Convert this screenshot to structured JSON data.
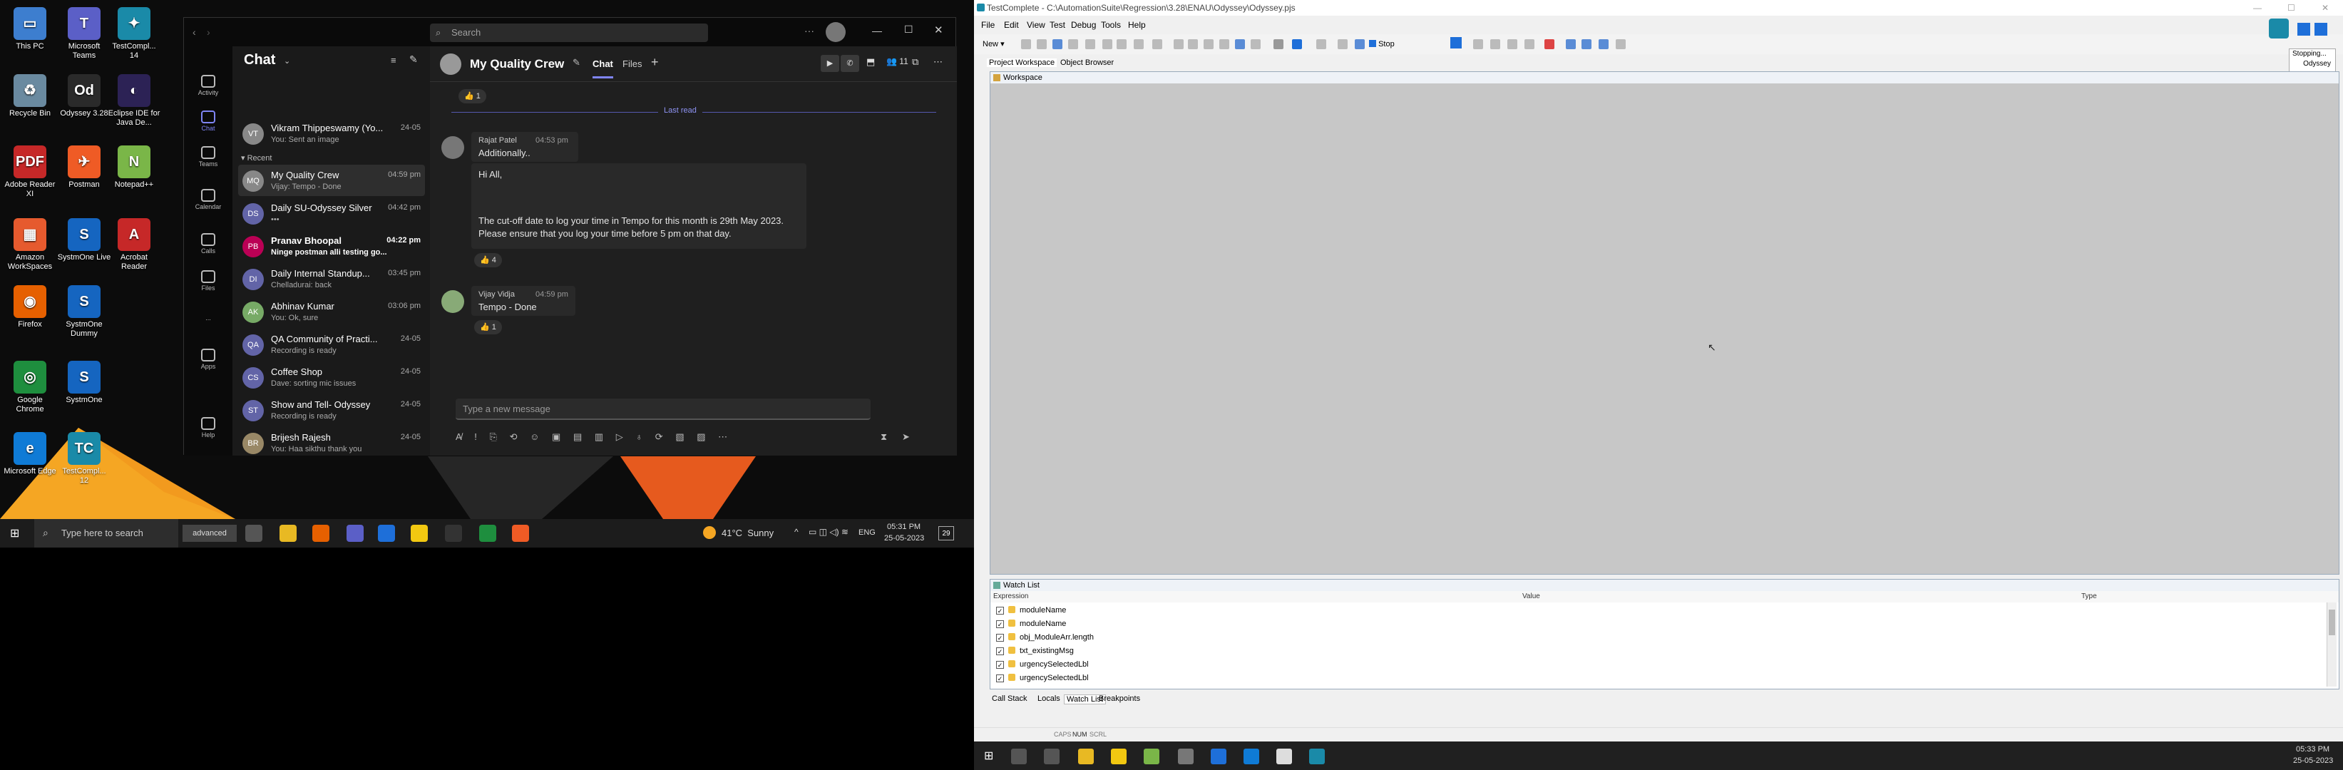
{
  "desktop": {
    "icons": [
      {
        "label": "This PC",
        "color": "#3d7ecf",
        "glyph": "▭"
      },
      {
        "label": "Microsoft Teams",
        "color": "#5b5fc7",
        "glyph": "T"
      },
      {
        "label": "TestCompl... 14",
        "color": "#1a8aa8",
        "glyph": "✦"
      },
      {
        "label": "Recycle Bin",
        "color": "#6a8aa0",
        "glyph": "♻"
      },
      {
        "label": "Odyssey 3.28",
        "color": "#2a2a2a",
        "glyph": "Od"
      },
      {
        "label": "Eclipse IDE for Java De...",
        "color": "#2c2255",
        "glyph": "◐"
      },
      {
        "label": "Adobe Reader XI",
        "color": "#c62828",
        "glyph": "PDF"
      },
      {
        "label": "Postman",
        "color": "#ef5b25",
        "glyph": "✈"
      },
      {
        "label": "Notepad++",
        "color": "#7ab648",
        "glyph": "N"
      },
      {
        "label": "Amazon WorkSpaces",
        "color": "#e65a2e",
        "glyph": "▦"
      },
      {
        "label": "SystmOne Live",
        "color": "#1565c0",
        "glyph": "S"
      },
      {
        "label": "Acrobat Reader",
        "color": "#c62828",
        "glyph": "A"
      },
      {
        "label": "Firefox",
        "color": "#e66000",
        "glyph": "◉"
      },
      {
        "label": "SystmOne Dummy",
        "color": "#1565c0",
        "glyph": "S"
      },
      {
        "label": "Google Chrome",
        "color": "#1e8e3e",
        "glyph": "◎"
      },
      {
        "label": "SystmOne",
        "color": "#1565c0",
        "glyph": "S"
      },
      {
        "label": "Microsoft Edge",
        "color": "#0f7bd6",
        "glyph": "e"
      },
      {
        "label": "TestCompl... 12",
        "color": "#1a8aa8",
        "glyph": "TC"
      }
    ]
  },
  "teams": {
    "search_placeholder": "Search",
    "rail": [
      "Activity",
      "Chat",
      "Teams",
      "Calendar",
      "Calls",
      "Files",
      "...",
      "Apps",
      "Help"
    ],
    "chat_header": "Chat",
    "recent_label": "Recent",
    "pinned_row": {
      "name": "Vikram Thippeswamy (Yo...",
      "preview": "You: Sent an image",
      "time": "24-05"
    },
    "chats": [
      {
        "name": "My Quality Crew",
        "preview": "Vijay: Tempo - Done",
        "time": "04:59 pm",
        "initials": "MQ",
        "bold": false
      },
      {
        "name": "Daily SU-Odyssey Silver",
        "preview": "•••",
        "time": "04:42 pm",
        "initials": "DS",
        "bold": false
      },
      {
        "name": "Pranav Bhoopal",
        "preview": "Ninge postman alli testing go...",
        "time": "04:22 pm",
        "initials": "PB",
        "bold": true
      },
      {
        "name": "Daily Internal Standup...",
        "preview": "Chelladurai: back",
        "time": "03:45 pm",
        "initials": "DI",
        "bold": false
      },
      {
        "name": "Abhinav Kumar",
        "preview": "You: Ok, sure",
        "time": "03:06 pm",
        "initials": "AK",
        "bold": false
      },
      {
        "name": "QA Community of Practi...",
        "preview": "Recording is ready",
        "time": "24-05",
        "initials": "QA",
        "bold": false
      },
      {
        "name": "Coffee Shop",
        "preview": "Dave: sorting mic issues",
        "time": "24-05",
        "initials": "CS",
        "bold": false
      },
      {
        "name": "Show and Tell- Odyssey",
        "preview": "Recording is ready",
        "time": "24-05",
        "initials": "ST",
        "bold": false
      },
      {
        "name": "Brijesh Rajesh",
        "preview": "You: Haa sikthu thank you",
        "time": "24-05",
        "initials": "BR",
        "bold": false
      }
    ],
    "conversation": {
      "title": "My Quality Crew",
      "tab_chat": "Chat",
      "tab_files": "Files",
      "participants": "11",
      "last_read": "Last read",
      "top_reaction": "👍 1",
      "messages": [
        {
          "author": "Rajat Patel",
          "time": "04:53 pm",
          "text": "Additionally.."
        },
        {
          "author": "",
          "time": "",
          "text": "Hi All,"
        },
        {
          "author": "",
          "time": "",
          "text": "The cut-off date to log your time in Tempo for this month is 29th May 2023. Please ensure that you log your time before 5 pm on that day."
        },
        {
          "author": "Vijay Vidja",
          "time": "04:59 pm",
          "text": "Tempo - Done"
        }
      ],
      "reaction_msg2": "👍 4",
      "reaction_msg3": "👍 1",
      "compose_placeholder": "Type a new message"
    }
  },
  "taskbar_left": {
    "search_placeholder": "Type here to search",
    "advanced_label": "advanced",
    "weather": "41°C  Sunny",
    "lang": "ENG",
    "time": "05:31 PM",
    "date": "25-05-2023",
    "notif": "29"
  },
  "testcomplete": {
    "title": "TestComplete - C:\\AutomationSuite\\Regression\\3.28\\ENAU\\Odyssey\\Odyssey.pjs",
    "menu": [
      "File",
      "Edit",
      "View",
      "Test",
      "Debug",
      "Tools",
      "Help"
    ],
    "new_label": "New",
    "stop_label": "Stop",
    "tabs": [
      "Project Workspace",
      "Object Browser"
    ],
    "workspace_label": "Workspace",
    "stopping_label": "Stopping...",
    "odyssey_label": "Odyssey",
    "watch_title": "Watch List",
    "columns": [
      "Expression",
      "Value",
      "Type"
    ],
    "watch_rows": [
      "moduleName",
      "moduleName",
      "obj_ModuleArr.length",
      "txt_existingMsg",
      "urgencySelectedLbl",
      "urgencySelectedLbl"
    ],
    "bottom_tabs": [
      "Call Stack",
      "Locals",
      "Watch List",
      "Breakpoints"
    ],
    "status_caps": "CAPS",
    "status_num": "NUM",
    "status_scrl": "SCRL"
  },
  "taskbar_right": {
    "time": "05:33 PM",
    "date": "25-05-2023"
  }
}
